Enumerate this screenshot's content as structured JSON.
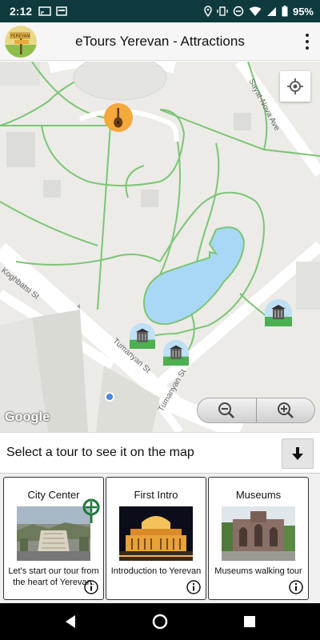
{
  "status_bar": {
    "time": "2:12",
    "battery": "95%"
  },
  "app_bar": {
    "title": "eTours Yerevan - Attractions",
    "logo_text": "YEREVAN"
  },
  "map": {
    "streets": {
      "s1": "Sayat-Nova Ave",
      "s2": "Koghbatsi St",
      "s3": "Tumanyan St",
      "s4": "Tumanyan St"
    },
    "attribution": "Google"
  },
  "select_bar": {
    "label": "Select a tour to see it on the map"
  },
  "tours": [
    {
      "title": "City Center",
      "description": "Let's start our tour from the heart of Yerevan."
    },
    {
      "title": "First Intro",
      "description": "Introduction to Yerevan"
    },
    {
      "title": "Museums",
      "description": "Museums walking tour"
    }
  ],
  "colors": {
    "status_bar": "#0e3a3d",
    "map_background": "#ecebe7",
    "park_path": "#7cc576",
    "lake": "#a8d8f5",
    "marker_orange": "#f4a93c",
    "marker_blue": "#4a89dc"
  }
}
